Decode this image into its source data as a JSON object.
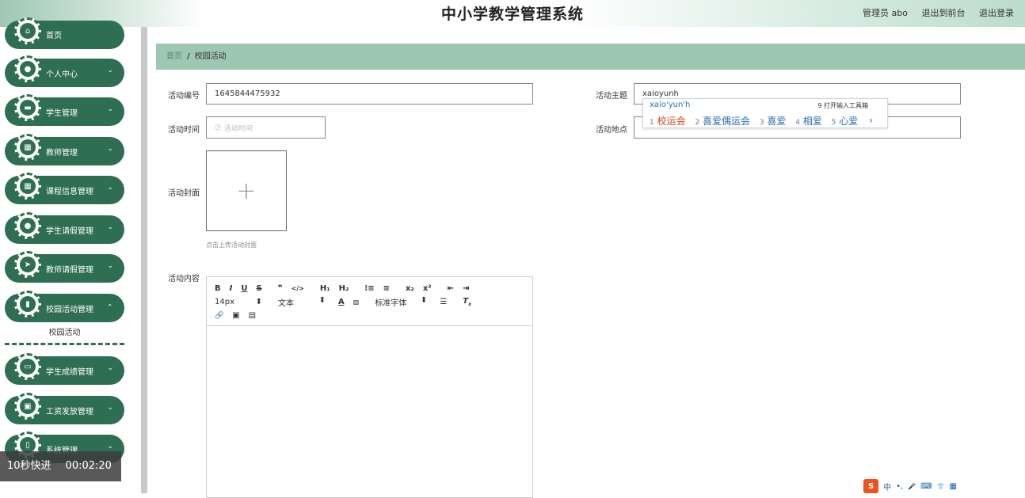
{
  "header": {
    "title": "中小学教学管理系统",
    "user": "管理员 abo",
    "to_front": "退出到前台",
    "logout": "退出登录"
  },
  "sidebar": {
    "items": [
      {
        "label": "首页",
        "icon": "home-icon",
        "glyph": "⌂"
      },
      {
        "label": "个人中心",
        "icon": "user-icon",
        "glyph": "●"
      },
      {
        "label": "学生管理",
        "icon": "briefcase-icon",
        "glyph": "▬"
      },
      {
        "label": "教师管理",
        "icon": "grid-icon",
        "glyph": "▦"
      },
      {
        "label": "课程信息管理",
        "icon": "grid-icon",
        "glyph": "▦"
      },
      {
        "label": "学生请假管理",
        "icon": "user-icon",
        "glyph": "●"
      },
      {
        "label": "教师请假管理",
        "icon": "send-icon",
        "glyph": "➤"
      },
      {
        "label": "校园活动管理",
        "icon": "book-icon",
        "glyph": "▮"
      },
      {
        "label": "学生成绩管理",
        "icon": "monitor-icon",
        "glyph": "▭"
      },
      {
        "label": "工资发放管理",
        "icon": "clipboard-icon",
        "glyph": "▣"
      },
      {
        "label": "系统管理",
        "icon": "trash-icon",
        "glyph": "▯"
      }
    ],
    "active_sub": "校园活动",
    "chevron": "⌄"
  },
  "video": {
    "skip": "10秒快进",
    "time": "00:02:20"
  },
  "breadcrumb": {
    "home": "首页",
    "sep": "/",
    "current": "校园活动"
  },
  "form": {
    "number_label": "活动编号",
    "number_value": "1645844475932",
    "theme_label": "活动主题",
    "theme_value": "xaioyunh",
    "time_label": "活动时间",
    "time_placeholder": "活动时间",
    "place_label": "活动地点",
    "cover_label": "活动封面",
    "upload_plus": "+",
    "upload_tip": "点击上传活动封面",
    "content_label": "活动内容"
  },
  "editor": {
    "row1": [
      "B",
      "I",
      "U",
      "S",
      "❞",
      "</>",
      "H₁",
      "H₂",
      "⁝≡",
      "≡",
      "x₂",
      "x²",
      "⇤",
      "⇥"
    ],
    "font_size": "14px",
    "text_type": "文本",
    "font_family": "标准字体",
    "row3": [
      "🔗",
      "▣",
      "▤"
    ]
  },
  "ime": {
    "pinyin": "xaio'yun'h",
    "tool": "9 打开输入工具箱",
    "candidates": [
      {
        "n": "1",
        "text": "校运会"
      },
      {
        "n": "2",
        "text": "喜爱偶运会"
      },
      {
        "n": "3",
        "text": "喜爱"
      },
      {
        "n": "4",
        "text": "相爱"
      },
      {
        "n": "5",
        "text": "心爱"
      }
    ],
    "arrow": "›",
    "bar_logo": "S",
    "bar_items": [
      "中",
      "•,",
      "🎤",
      "⌨",
      "👕",
      "▦"
    ]
  }
}
